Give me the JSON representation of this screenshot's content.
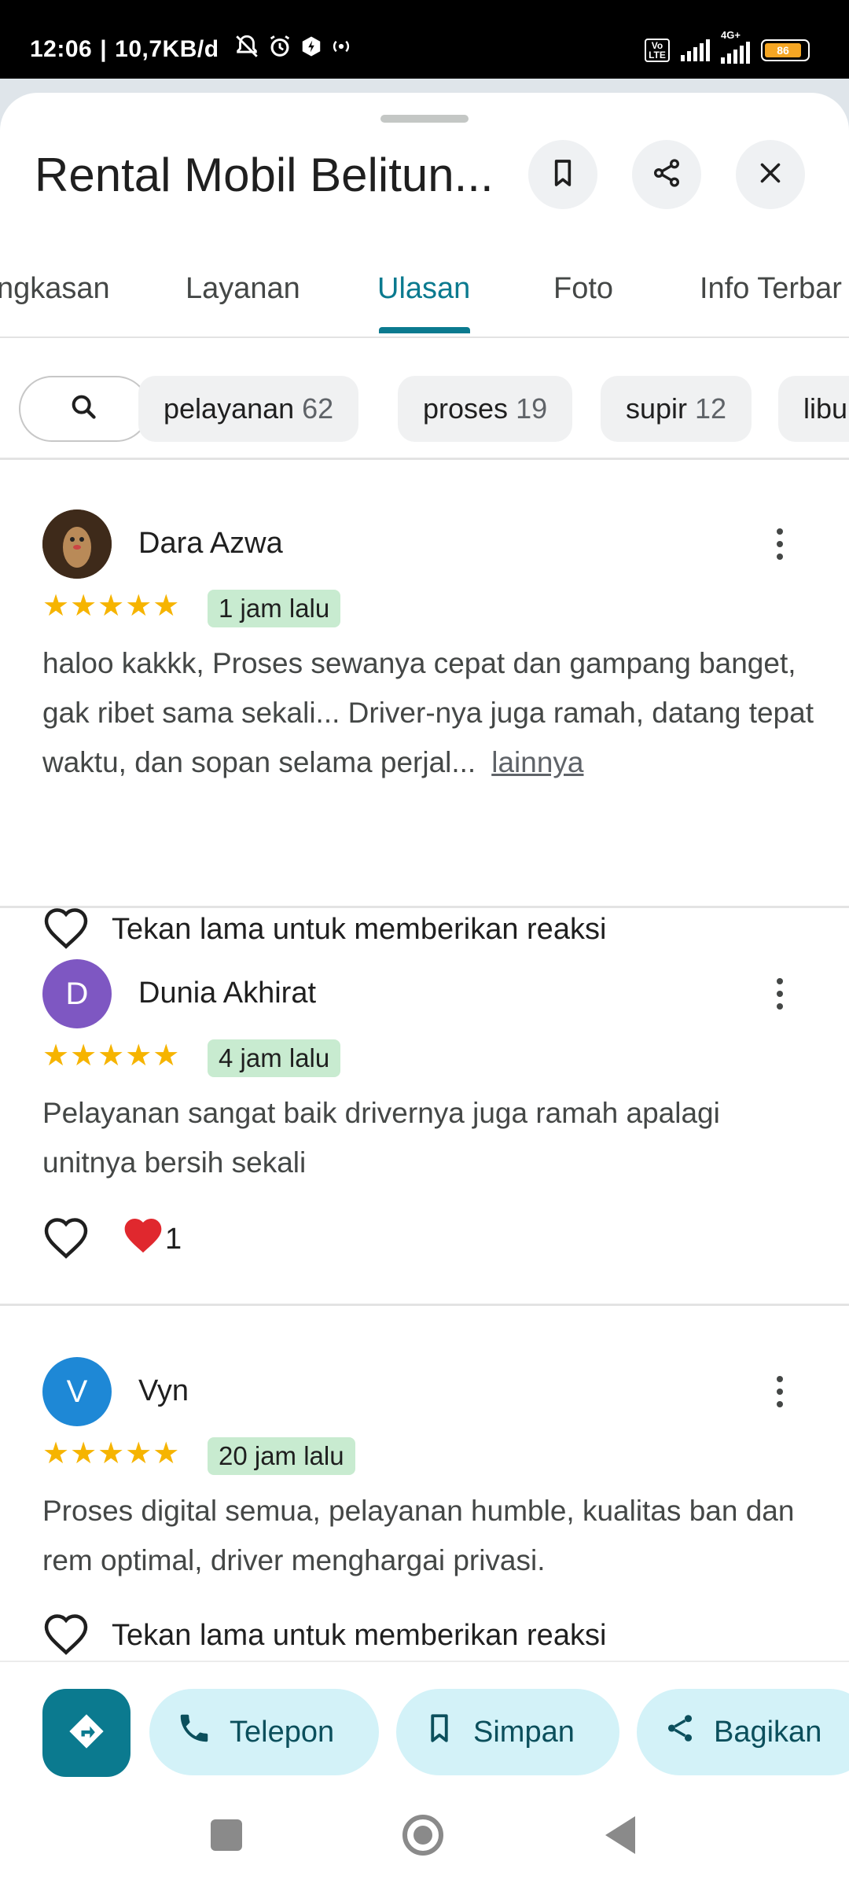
{
  "status_bar": {
    "time": "12:06",
    "net_speed": "10,7KB/d",
    "volte": "Vo LTE",
    "network": "4G+",
    "battery": "86"
  },
  "place": {
    "title": "Rental Mobil Belitun..."
  },
  "tabs": [
    {
      "label": "ngkasan",
      "active": false
    },
    {
      "label": "Layanan",
      "active": false
    },
    {
      "label": "Ulasan",
      "active": true
    },
    {
      "label": "Foto",
      "active": false
    },
    {
      "label": "Info Terbar",
      "active": false
    }
  ],
  "filters": [
    {
      "label": "pelayanan",
      "count": "62"
    },
    {
      "label": "proses",
      "count": "19"
    },
    {
      "label": "supir",
      "count": "12"
    },
    {
      "label": "libu",
      "count": ""
    }
  ],
  "reviews": [
    {
      "name": "Dara Azwa",
      "avatar_letter": "",
      "avatar_color": "#5b3a1e",
      "stars": "★★★★★",
      "rating": 5,
      "time": "1 jam lalu",
      "text": "haloo kakkk, Proses sewanya cepat dan gampang banget, gak ribet sama sekali... Driver-nya juga ramah, datang tepat waktu, dan sopan selama perjal...",
      "more_label": "lainnya",
      "reaction_text": "Tekan lama untuk memberikan reaksi",
      "reaction_count": ""
    },
    {
      "name": "Dunia Akhirat",
      "avatar_letter": "D",
      "avatar_color": "#7e57c2",
      "stars": "★★★★★",
      "rating": 5,
      "time": "4 jam lalu",
      "text": "Pelayanan sangat baik drivernya juga ramah apalagi unitnya bersih sekali",
      "more_label": "",
      "reaction_text": "",
      "reaction_count": "1"
    },
    {
      "name": "Vyn",
      "avatar_letter": "V",
      "avatar_color": "#1e88d6",
      "stars": "★★★★★",
      "rating": 5,
      "time": "20 jam lalu",
      "text": "Proses digital semua, pelayanan humble, kualitas ban dan rem optimal, driver menghargai privasi.",
      "more_label": "",
      "reaction_text": "Tekan lama untuk memberikan reaksi",
      "reaction_count": ""
    }
  ],
  "actions": {
    "call": "Telepon",
    "save": "Simpan",
    "share": "Bagikan"
  },
  "colors": {
    "accent": "#0b7a8f",
    "pill_bg": "#d3f2f8",
    "star": "#f6b400",
    "badge_bg": "#c8ebd0"
  }
}
